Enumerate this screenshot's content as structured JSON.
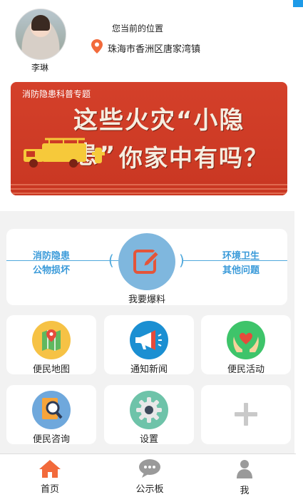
{
  "header": {
    "username": "李琳",
    "location_label": "您当前的位置",
    "location_value": "珠海市香洲区唐家湾镇"
  },
  "banner": {
    "tag": "消防隐患科普专题",
    "headline1": "这些火灾“小隐患”",
    "headline2": "你家中有吗？"
  },
  "report": {
    "left_top": "消防隐患",
    "left_bottom": "公物损坏",
    "right_top": "环境卫生",
    "right_bottom": "其他问题",
    "label": "我要爆料"
  },
  "tiles": [
    {
      "label": "便民地图",
      "icon": "map-icon",
      "color": "#f6c245"
    },
    {
      "label": "通知新闻",
      "icon": "megaphone-icon",
      "color": "#1b8fd2"
    },
    {
      "label": "便民活动",
      "icon": "hands-heart-icon",
      "color": "#3ec46a"
    },
    {
      "label": "便民咨询",
      "icon": "search-doc-icon",
      "color": "#6fa8dc"
    },
    {
      "label": "设置",
      "icon": "gear-icon",
      "color": "#6ec3a9"
    },
    {
      "label": "",
      "icon": "add-icon",
      "color": "#ffffff"
    }
  ],
  "nav": [
    {
      "label": "首页",
      "icon": "home-icon",
      "color": "#f26a3b"
    },
    {
      "label": "公示板",
      "icon": "chat-icon",
      "color": "#9a9a9a"
    },
    {
      "label": "我",
      "icon": "user-icon",
      "color": "#9a9a9a"
    }
  ]
}
